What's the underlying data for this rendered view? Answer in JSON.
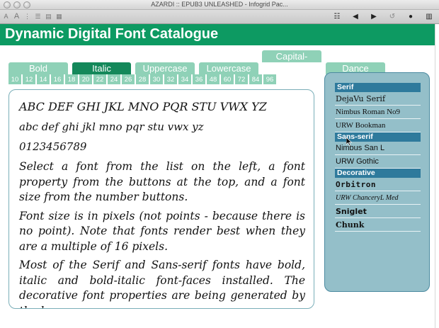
{
  "window": {
    "title": "AZARDI :: EPUB3 UNLEASHED - Infogrid Pac..."
  },
  "toolbar": {
    "left_icons": [
      "font-size-small-icon",
      "font-size-large-icon",
      "text-format-icon",
      "toc-icon",
      "print-icon",
      "grid-icon"
    ],
    "right_icons": [
      "list-icon",
      "back-icon",
      "forward-icon",
      "reload-icon",
      "user-icon",
      "library-icon"
    ]
  },
  "header": {
    "title": "Dynamic Digital Font Catalogue",
    "color": "#0d9a62"
  },
  "properties": {
    "bold": "Bold",
    "italic": "Italic",
    "uppercase": "Uppercase",
    "lowercase": "Lowercase",
    "capitalize": "Capital-",
    "dance": "Dance",
    "active": "Italic"
  },
  "sizes": [
    "10",
    "12",
    "14",
    "16",
    "18",
    "20",
    "22",
    "24",
    "26",
    "28",
    "30",
    "32",
    "34",
    "36",
    "48",
    "60",
    "72",
    "84",
    "96"
  ],
  "sample": {
    "uppercase": "ABC DEF GHI JKL MNO PQR STU VWX YZ",
    "lowercase": "abc def ghi jkl mno pqr stu vwx yz",
    "digits": "0123456789",
    "para1": "Select a font from the list on the left, a font property from the buttons at the top, and a font size from the number buttons.",
    "para2": "Font size is in pixels (not points - because there is no point). Note that fonts render best when they are a multiple of 16 pixels.",
    "para3": "Most of the Serif and Sans-serif fonts have bold, italic and bold-italic font-faces installed. The decorative font properties are being generated by the browser."
  },
  "fonts": {
    "serif_label": "Serif",
    "serif": [
      "DejaVu Serif",
      "Nimbus Roman No9",
      "URW Bookman"
    ],
    "sans_label": "Sans-serif",
    "sans": [
      "Nimbus San L",
      "URW Gothic"
    ],
    "decorative_label": "Decorative",
    "decorative": [
      "Orbitron",
      "URW ChanceryL Med",
      "Sniglet",
      "Chunk"
    ]
  }
}
